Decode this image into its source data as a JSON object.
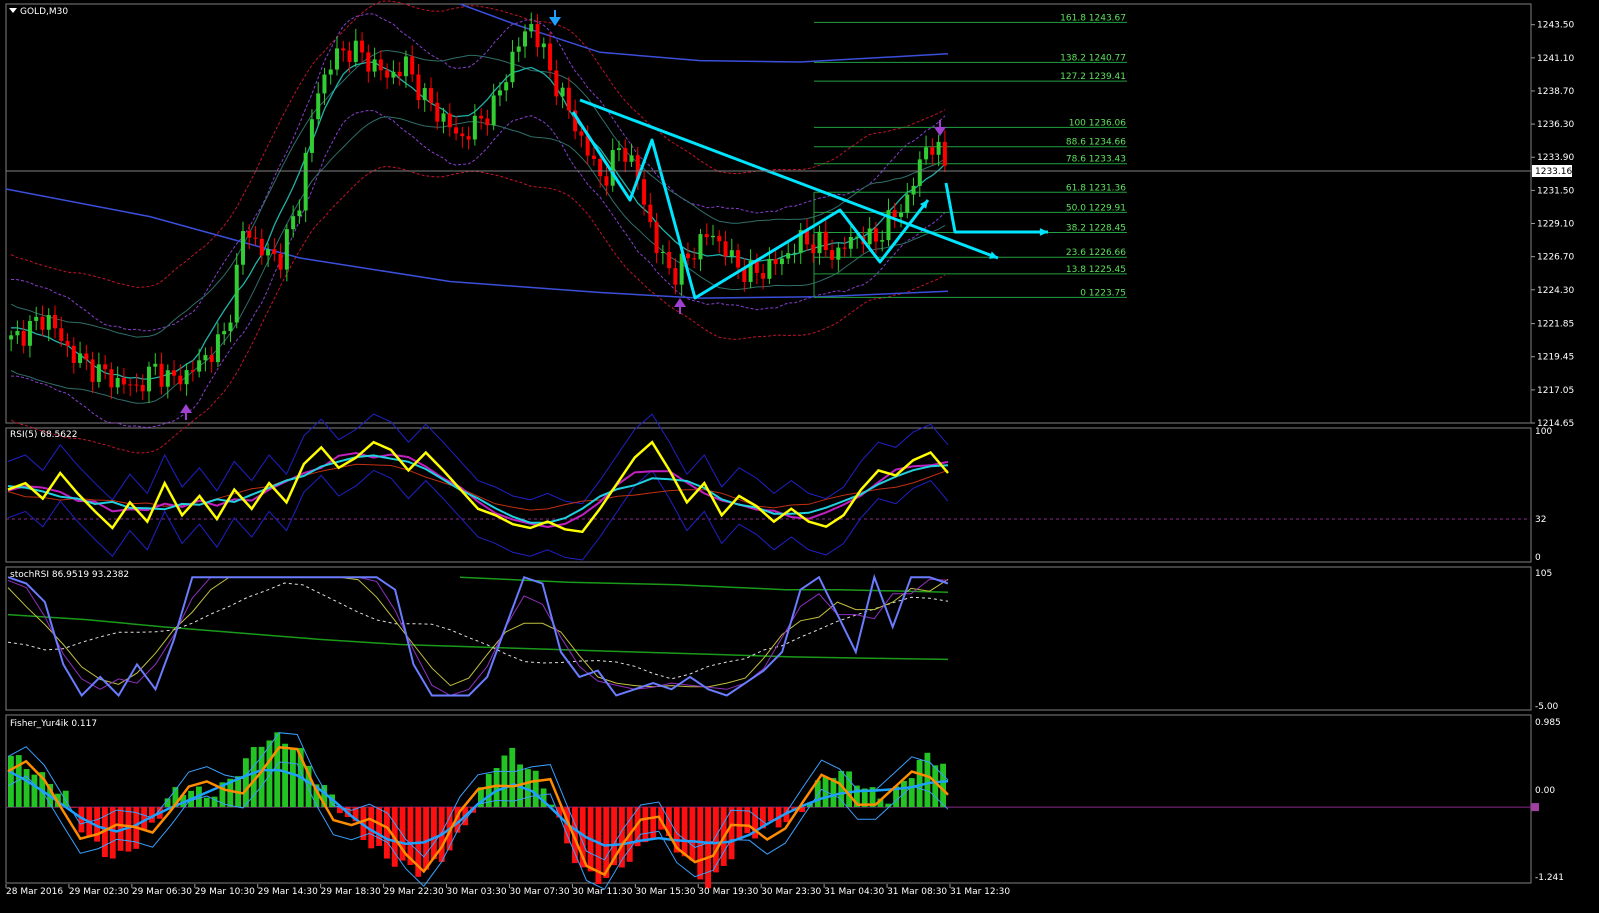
{
  "symbol_label": "GOLD,M30",
  "current_price": "1233.16",
  "colors": {
    "background": "#000000",
    "bull": "#32cd32",
    "bear": "#ff0000",
    "ma": "#3b4fdb",
    "bands_red": "#c0142c",
    "bands_purple": "#8a3fd0",
    "teal": "#20b2aa",
    "fib": "#20a040",
    "arrows": "#00e5ff",
    "rsi": "#ffff00",
    "stoch": "#6a7cff",
    "fisher_pos": "#22c322",
    "fisher_neg": "#ff1010",
    "fisher_line": "#ff8c00",
    "fisher_signal": "#1ea0ff"
  },
  "panels": {
    "rsi": {
      "label": "RSI(5) 68.5622",
      "scale": [
        "100",
        "32",
        "0"
      ]
    },
    "stoch": {
      "label": "stochRSI 86.9519 93.2382",
      "scale": [
        "105",
        "-5.00"
      ]
    },
    "fisher": {
      "label": "Fisher_Yur4ik 0.117",
      "scale": [
        "0.985",
        "0.00",
        "-1.241"
      ]
    }
  },
  "chart_data": [
    {
      "type": "candlestick",
      "title": "GOLD,M30",
      "price_axis": [
        "1243.50",
        "1241.10",
        "1238.70",
        "1236.30",
        "1233.90",
        "1231.50",
        "1229.10",
        "1226.70",
        "1224.30",
        "1221.85",
        "1219.45",
        "1217.05",
        "1214.65"
      ],
      "ylim": [
        1214.65,
        1245.0
      ],
      "time_axis": [
        "28 Mar 2016",
        "29 Mar 02:30",
        "29 Mar 06:30",
        "29 Mar 10:30",
        "29 Mar 14:30",
        "29 Mar 18:30",
        "29 Mar 22:30",
        "30 Mar 03:30",
        "30 Mar 07:30",
        "30 Mar 11:30",
        "30 Mar 15:30",
        "30 Mar 19:30",
        "30 Mar 23:30",
        "31 Mar 04:30",
        "31 Mar 08:30",
        "31 Mar 12:30"
      ],
      "close_path": [
        1220.6,
        1221.5,
        1222.4,
        1220.2,
        1219.0,
        1218.3,
        1217.6,
        1217.2,
        1218.6,
        1217.7,
        1218.4,
        1219.6,
        1221.2,
        1229.0,
        1227.0,
        1226.6,
        1230.5,
        1238.5,
        1241.2,
        1241.8,
        1240.8,
        1239.7,
        1240.6,
        1238.2,
        1236.8,
        1235.2,
        1236.4,
        1237.8,
        1241.5,
        1243.6,
        1240.2,
        1237.4,
        1234.5,
        1232.1,
        1235.0,
        1232.0,
        1227.0,
        1225.4,
        1227.2,
        1228.5,
        1226.7,
        1225.4,
        1225.8,
        1226.6,
        1227.9,
        1227.6,
        1226.8,
        1228.3,
        1227.8,
        1229.4,
        1231.0,
        1235.0,
        1233.6
      ],
      "fibonacci": [
        {
          "level": "161.8",
          "price": "1243.67"
        },
        {
          "level": "138.2",
          "price": "1240.77"
        },
        {
          "level": "127.2",
          "price": "1239.41"
        },
        {
          "level": "100",
          "price": "1236.06"
        },
        {
          "level": "88.6",
          "price": "1234.66"
        },
        {
          "level": "78.6",
          "price": "1233.43"
        },
        {
          "level": "61.8",
          "price": "1231.36"
        },
        {
          "level": "50.0",
          "price": "1229.91"
        },
        {
          "level": "38.2",
          "price": "1228.45"
        },
        {
          "level": "23.6",
          "price": "1226.66"
        },
        {
          "level": "13.8",
          "price": "1225.45"
        },
        {
          "level": "0",
          "price": "1223.75"
        }
      ]
    },
    {
      "type": "line",
      "title": "RSI(5) 68.5622",
      "ylim": [
        0,
        100
      ],
      "levels": [
        32
      ],
      "rsi": [
        55,
        60,
        48,
        68,
        52,
        38,
        25,
        45,
        30,
        60,
        35,
        50,
        32,
        55,
        40,
        60,
        45,
        75,
        88,
        72,
        80,
        92,
        86,
        70,
        84,
        70,
        55,
        40,
        35,
        28,
        25,
        30,
        24,
        22,
        40,
        60,
        80,
        92,
        70,
        45,
        60,
        35,
        50,
        42,
        30,
        40,
        30,
        26,
        35,
        55,
        70,
        66,
        78,
        84,
        68
      ]
    },
    {
      "type": "line",
      "title": "stochRSI 86.9519 93.2382",
      "ylim": [
        -5,
        105
      ],
      "stoch": [
        100,
        95,
        80,
        30,
        5,
        20,
        5,
        30,
        10,
        50,
        100,
        100,
        100,
        100,
        100,
        100,
        100,
        100,
        100,
        100,
        100,
        90,
        30,
        5,
        5,
        5,
        20,
        60,
        100,
        95,
        40,
        20,
        25,
        5,
        10,
        15,
        10,
        20,
        10,
        5,
        15,
        25,
        40,
        90,
        100,
        70,
        40,
        100,
        60,
        100,
        100,
        95
      ]
    },
    {
      "type": "bar",
      "title": "Fisher_Yur4ik 0.117",
      "ylim": [
        -1.241,
        0.985
      ],
      "histogram": [
        0.7,
        0.55,
        0.35,
        0.2,
        -0.3,
        -0.6,
        -0.7,
        -0.5,
        -0.2,
        0.2,
        0.25,
        0.15,
        0.3,
        0.6,
        0.9,
        0.95,
        0.8,
        0.4,
        0.1,
        -0.2,
        -0.5,
        -0.7,
        -0.8,
        -0.9,
        -0.7,
        -0.4,
        0.1,
        0.6,
        0.75,
        0.5,
        0.2,
        -0.5,
        -0.9,
        -1.0,
        -0.8,
        -0.6,
        -0.3,
        -0.5,
        -0.8,
        -1.1,
        -0.7,
        -0.4,
        -0.3,
        -0.2,
        -0.1,
        0.3,
        0.5,
        0.4,
        0.2,
        0.1,
        0.4,
        0.7,
        0.6
      ]
    }
  ]
}
